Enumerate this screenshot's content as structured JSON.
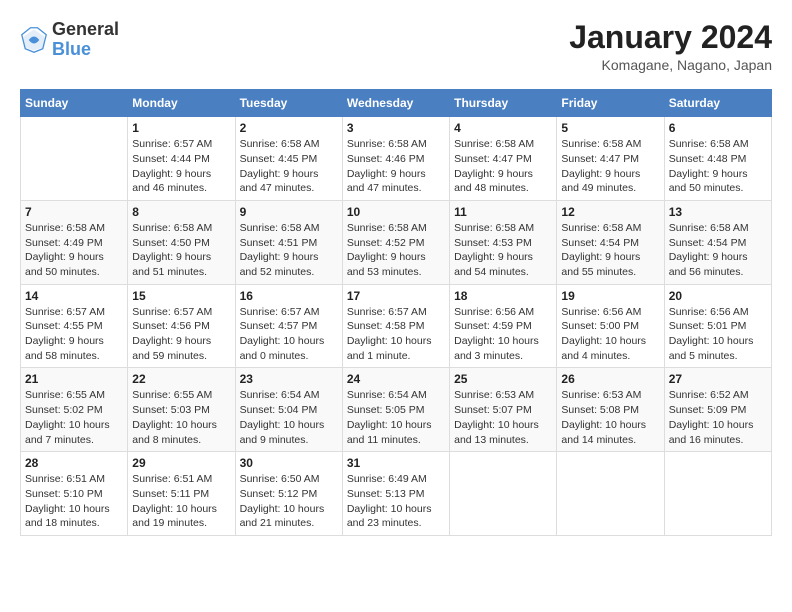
{
  "header": {
    "logo": {
      "general": "General",
      "blue": "Blue"
    },
    "title": "January 2024",
    "subtitle": "Komagane, Nagano, Japan"
  },
  "days_of_week": [
    "Sunday",
    "Monday",
    "Tuesday",
    "Wednesday",
    "Thursday",
    "Friday",
    "Saturday"
  ],
  "weeks": [
    [
      {
        "day": "",
        "info": ""
      },
      {
        "day": "1",
        "info": "Sunrise: 6:57 AM\nSunset: 4:44 PM\nDaylight: 9 hours\nand 46 minutes."
      },
      {
        "day": "2",
        "info": "Sunrise: 6:58 AM\nSunset: 4:45 PM\nDaylight: 9 hours\nand 47 minutes."
      },
      {
        "day": "3",
        "info": "Sunrise: 6:58 AM\nSunset: 4:46 PM\nDaylight: 9 hours\nand 47 minutes."
      },
      {
        "day": "4",
        "info": "Sunrise: 6:58 AM\nSunset: 4:47 PM\nDaylight: 9 hours\nand 48 minutes."
      },
      {
        "day": "5",
        "info": "Sunrise: 6:58 AM\nSunset: 4:47 PM\nDaylight: 9 hours\nand 49 minutes."
      },
      {
        "day": "6",
        "info": "Sunrise: 6:58 AM\nSunset: 4:48 PM\nDaylight: 9 hours\nand 50 minutes."
      }
    ],
    [
      {
        "day": "7",
        "info": "Sunrise: 6:58 AM\nSunset: 4:49 PM\nDaylight: 9 hours\nand 50 minutes."
      },
      {
        "day": "8",
        "info": "Sunrise: 6:58 AM\nSunset: 4:50 PM\nDaylight: 9 hours\nand 51 minutes."
      },
      {
        "day": "9",
        "info": "Sunrise: 6:58 AM\nSunset: 4:51 PM\nDaylight: 9 hours\nand 52 minutes."
      },
      {
        "day": "10",
        "info": "Sunrise: 6:58 AM\nSunset: 4:52 PM\nDaylight: 9 hours\nand 53 minutes."
      },
      {
        "day": "11",
        "info": "Sunrise: 6:58 AM\nSunset: 4:53 PM\nDaylight: 9 hours\nand 54 minutes."
      },
      {
        "day": "12",
        "info": "Sunrise: 6:58 AM\nSunset: 4:54 PM\nDaylight: 9 hours\nand 55 minutes."
      },
      {
        "day": "13",
        "info": "Sunrise: 6:58 AM\nSunset: 4:54 PM\nDaylight: 9 hours\nand 56 minutes."
      }
    ],
    [
      {
        "day": "14",
        "info": "Sunrise: 6:57 AM\nSunset: 4:55 PM\nDaylight: 9 hours\nand 58 minutes."
      },
      {
        "day": "15",
        "info": "Sunrise: 6:57 AM\nSunset: 4:56 PM\nDaylight: 9 hours\nand 59 minutes."
      },
      {
        "day": "16",
        "info": "Sunrise: 6:57 AM\nSunset: 4:57 PM\nDaylight: 10 hours\nand 0 minutes."
      },
      {
        "day": "17",
        "info": "Sunrise: 6:57 AM\nSunset: 4:58 PM\nDaylight: 10 hours\nand 1 minute."
      },
      {
        "day": "18",
        "info": "Sunrise: 6:56 AM\nSunset: 4:59 PM\nDaylight: 10 hours\nand 3 minutes."
      },
      {
        "day": "19",
        "info": "Sunrise: 6:56 AM\nSunset: 5:00 PM\nDaylight: 10 hours\nand 4 minutes."
      },
      {
        "day": "20",
        "info": "Sunrise: 6:56 AM\nSunset: 5:01 PM\nDaylight: 10 hours\nand 5 minutes."
      }
    ],
    [
      {
        "day": "21",
        "info": "Sunrise: 6:55 AM\nSunset: 5:02 PM\nDaylight: 10 hours\nand 7 minutes."
      },
      {
        "day": "22",
        "info": "Sunrise: 6:55 AM\nSunset: 5:03 PM\nDaylight: 10 hours\nand 8 minutes."
      },
      {
        "day": "23",
        "info": "Sunrise: 6:54 AM\nSunset: 5:04 PM\nDaylight: 10 hours\nand 9 minutes."
      },
      {
        "day": "24",
        "info": "Sunrise: 6:54 AM\nSunset: 5:05 PM\nDaylight: 10 hours\nand 11 minutes."
      },
      {
        "day": "25",
        "info": "Sunrise: 6:53 AM\nSunset: 5:07 PM\nDaylight: 10 hours\nand 13 minutes."
      },
      {
        "day": "26",
        "info": "Sunrise: 6:53 AM\nSunset: 5:08 PM\nDaylight: 10 hours\nand 14 minutes."
      },
      {
        "day": "27",
        "info": "Sunrise: 6:52 AM\nSunset: 5:09 PM\nDaylight: 10 hours\nand 16 minutes."
      }
    ],
    [
      {
        "day": "28",
        "info": "Sunrise: 6:51 AM\nSunset: 5:10 PM\nDaylight: 10 hours\nand 18 minutes."
      },
      {
        "day": "29",
        "info": "Sunrise: 6:51 AM\nSunset: 5:11 PM\nDaylight: 10 hours\nand 19 minutes."
      },
      {
        "day": "30",
        "info": "Sunrise: 6:50 AM\nSunset: 5:12 PM\nDaylight: 10 hours\nand 21 minutes."
      },
      {
        "day": "31",
        "info": "Sunrise: 6:49 AM\nSunset: 5:13 PM\nDaylight: 10 hours\nand 23 minutes."
      },
      {
        "day": "",
        "info": ""
      },
      {
        "day": "",
        "info": ""
      },
      {
        "day": "",
        "info": ""
      }
    ]
  ]
}
